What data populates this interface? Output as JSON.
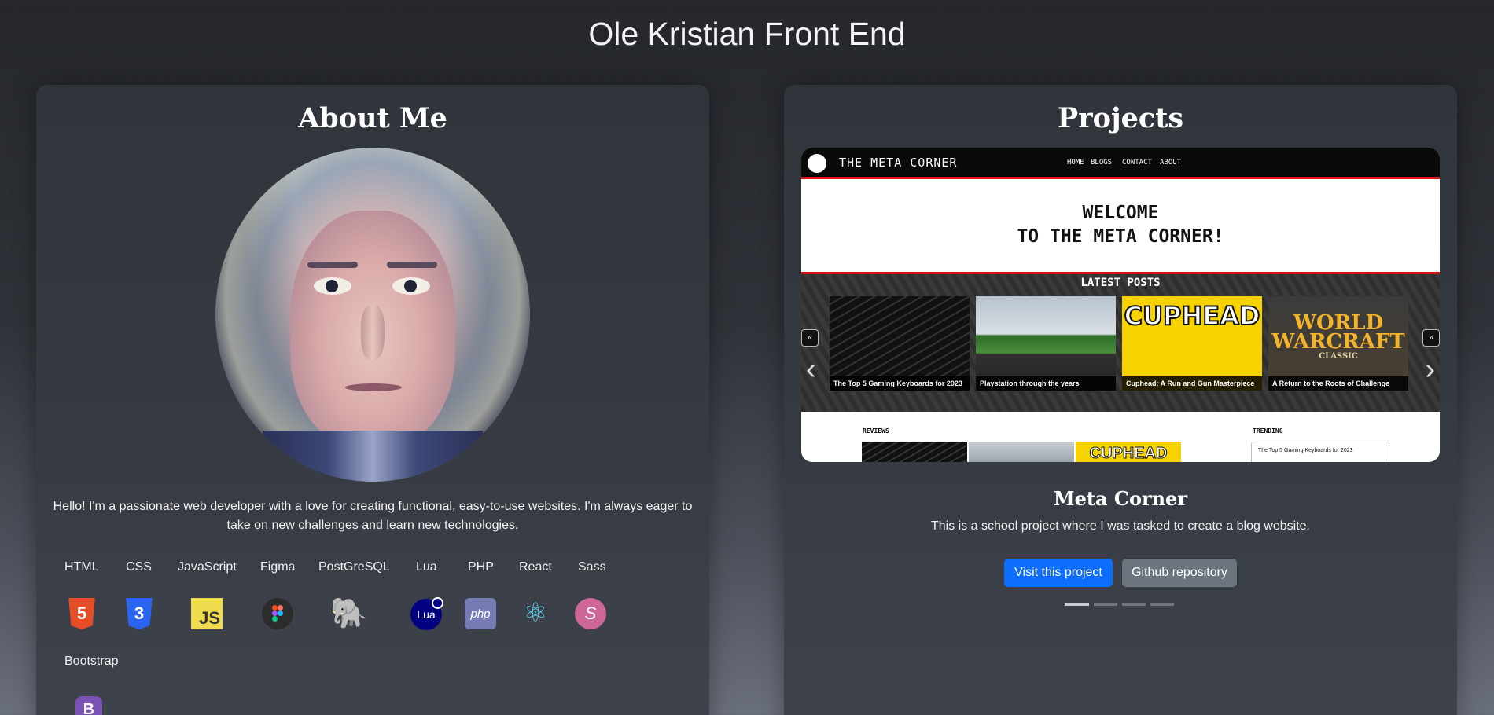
{
  "site": {
    "title": "Ole Kristian Front End"
  },
  "about": {
    "title": "About Me",
    "bio": "Hello! I'm a passionate web developer with a love for creating functional, easy-to-use websites. I'm always eager to take on new challenges and learn new technologies.",
    "skills": [
      {
        "label": "HTML",
        "icon": "html5-icon",
        "glyph": "5"
      },
      {
        "label": "CSS",
        "icon": "css3-icon",
        "glyph": "3"
      },
      {
        "label": "JavaScript",
        "icon": "javascript-icon",
        "glyph": "JS"
      },
      {
        "label": "Figma",
        "icon": "figma-icon",
        "glyph": ""
      },
      {
        "label": "PostGreSQL",
        "icon": "postgresql-icon",
        "glyph": "🐘"
      },
      {
        "label": "Lua",
        "icon": "lua-icon",
        "glyph": "Lua"
      },
      {
        "label": "PHP",
        "icon": "php-icon",
        "glyph": "php"
      },
      {
        "label": "React",
        "icon": "react-icon",
        "glyph": "⚛"
      },
      {
        "label": "Sass",
        "icon": "sass-icon",
        "glyph": "S"
      },
      {
        "label": "Bootstrap",
        "icon": "bootstrap-icon",
        "glyph": "B"
      }
    ]
  },
  "projects": {
    "title": "Projects",
    "screenshot": {
      "brand": "THE META CORNER",
      "nav": [
        "HOME",
        "BLOGS",
        "CONTACT",
        "ABOUT"
      ],
      "welcome_line1": "WELCOME",
      "welcome_line2": "TO THE META CORNER!",
      "latest_posts": "LATEST POSTS",
      "posts": [
        "The Top 5 Gaming Keyboards for 2023",
        "Playstation through the years",
        "Cuphead: A Run and Gun Masterpiece",
        "A Return to the Roots of Challenge"
      ],
      "cuphead_art": "CUPHEAD",
      "wow_art_1": "WORLD",
      "wow_art_2": "WARCRAFT",
      "wow_art_3": "CLASSIC",
      "prev_small": "«",
      "next_small": "»",
      "reviews_label": "REVIEWS",
      "trending_label": "TRENDING",
      "trending_item": "The Top 5 Gaming Keyboards for 2023",
      "mini_cuphead": "CUPHEAD"
    },
    "current": {
      "name": "Meta Corner",
      "description": "This is a school project where I was tasked to create a blog website.",
      "visit_label": "Visit this project",
      "repo_label": "Github repository"
    },
    "slides_count": 4,
    "active_slide": 0
  }
}
